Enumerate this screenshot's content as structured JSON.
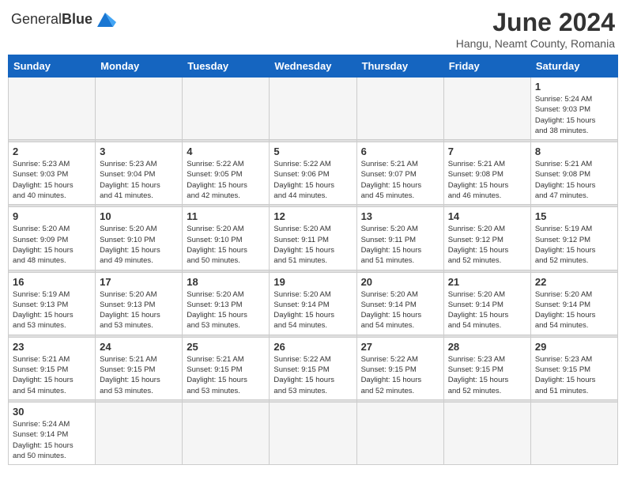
{
  "header": {
    "logo_text_normal": "General",
    "logo_text_bold": "Blue",
    "title": "June 2024",
    "subtitle": "Hangu, Neamt County, Romania"
  },
  "weekdays": [
    "Sunday",
    "Monday",
    "Tuesday",
    "Wednesday",
    "Thursday",
    "Friday",
    "Saturday"
  ],
  "weeks": [
    [
      {
        "day": "",
        "info": ""
      },
      {
        "day": "",
        "info": ""
      },
      {
        "day": "",
        "info": ""
      },
      {
        "day": "",
        "info": ""
      },
      {
        "day": "",
        "info": ""
      },
      {
        "day": "",
        "info": ""
      },
      {
        "day": "1",
        "info": "Sunrise: 5:24 AM\nSunset: 9:03 PM\nDaylight: 15 hours\nand 38 minutes."
      }
    ],
    [
      {
        "day": "2",
        "info": "Sunrise: 5:23 AM\nSunset: 9:03 PM\nDaylight: 15 hours\nand 40 minutes."
      },
      {
        "day": "3",
        "info": "Sunrise: 5:23 AM\nSunset: 9:04 PM\nDaylight: 15 hours\nand 41 minutes."
      },
      {
        "day": "4",
        "info": "Sunrise: 5:22 AM\nSunset: 9:05 PM\nDaylight: 15 hours\nand 42 minutes."
      },
      {
        "day": "5",
        "info": "Sunrise: 5:22 AM\nSunset: 9:06 PM\nDaylight: 15 hours\nand 44 minutes."
      },
      {
        "day": "6",
        "info": "Sunrise: 5:21 AM\nSunset: 9:07 PM\nDaylight: 15 hours\nand 45 minutes."
      },
      {
        "day": "7",
        "info": "Sunrise: 5:21 AM\nSunset: 9:08 PM\nDaylight: 15 hours\nand 46 minutes."
      },
      {
        "day": "8",
        "info": "Sunrise: 5:21 AM\nSunset: 9:08 PM\nDaylight: 15 hours\nand 47 minutes."
      }
    ],
    [
      {
        "day": "9",
        "info": "Sunrise: 5:20 AM\nSunset: 9:09 PM\nDaylight: 15 hours\nand 48 minutes."
      },
      {
        "day": "10",
        "info": "Sunrise: 5:20 AM\nSunset: 9:10 PM\nDaylight: 15 hours\nand 49 minutes."
      },
      {
        "day": "11",
        "info": "Sunrise: 5:20 AM\nSunset: 9:10 PM\nDaylight: 15 hours\nand 50 minutes."
      },
      {
        "day": "12",
        "info": "Sunrise: 5:20 AM\nSunset: 9:11 PM\nDaylight: 15 hours\nand 51 minutes."
      },
      {
        "day": "13",
        "info": "Sunrise: 5:20 AM\nSunset: 9:11 PM\nDaylight: 15 hours\nand 51 minutes."
      },
      {
        "day": "14",
        "info": "Sunrise: 5:20 AM\nSunset: 9:12 PM\nDaylight: 15 hours\nand 52 minutes."
      },
      {
        "day": "15",
        "info": "Sunrise: 5:19 AM\nSunset: 9:12 PM\nDaylight: 15 hours\nand 52 minutes."
      }
    ],
    [
      {
        "day": "16",
        "info": "Sunrise: 5:19 AM\nSunset: 9:13 PM\nDaylight: 15 hours\nand 53 minutes."
      },
      {
        "day": "17",
        "info": "Sunrise: 5:20 AM\nSunset: 9:13 PM\nDaylight: 15 hours\nand 53 minutes."
      },
      {
        "day": "18",
        "info": "Sunrise: 5:20 AM\nSunset: 9:13 PM\nDaylight: 15 hours\nand 53 minutes."
      },
      {
        "day": "19",
        "info": "Sunrise: 5:20 AM\nSunset: 9:14 PM\nDaylight: 15 hours\nand 54 minutes."
      },
      {
        "day": "20",
        "info": "Sunrise: 5:20 AM\nSunset: 9:14 PM\nDaylight: 15 hours\nand 54 minutes."
      },
      {
        "day": "21",
        "info": "Sunrise: 5:20 AM\nSunset: 9:14 PM\nDaylight: 15 hours\nand 54 minutes."
      },
      {
        "day": "22",
        "info": "Sunrise: 5:20 AM\nSunset: 9:14 PM\nDaylight: 15 hours\nand 54 minutes."
      }
    ],
    [
      {
        "day": "23",
        "info": "Sunrise: 5:21 AM\nSunset: 9:15 PM\nDaylight: 15 hours\nand 54 minutes."
      },
      {
        "day": "24",
        "info": "Sunrise: 5:21 AM\nSunset: 9:15 PM\nDaylight: 15 hours\nand 53 minutes."
      },
      {
        "day": "25",
        "info": "Sunrise: 5:21 AM\nSunset: 9:15 PM\nDaylight: 15 hours\nand 53 minutes."
      },
      {
        "day": "26",
        "info": "Sunrise: 5:22 AM\nSunset: 9:15 PM\nDaylight: 15 hours\nand 53 minutes."
      },
      {
        "day": "27",
        "info": "Sunrise: 5:22 AM\nSunset: 9:15 PM\nDaylight: 15 hours\nand 52 minutes."
      },
      {
        "day": "28",
        "info": "Sunrise: 5:23 AM\nSunset: 9:15 PM\nDaylight: 15 hours\nand 52 minutes."
      },
      {
        "day": "29",
        "info": "Sunrise: 5:23 AM\nSunset: 9:15 PM\nDaylight: 15 hours\nand 51 minutes."
      }
    ],
    [
      {
        "day": "30",
        "info": "Sunrise: 5:24 AM\nSunset: 9:14 PM\nDaylight: 15 hours\nand 50 minutes."
      },
      {
        "day": "",
        "info": ""
      },
      {
        "day": "",
        "info": ""
      },
      {
        "day": "",
        "info": ""
      },
      {
        "day": "",
        "info": ""
      },
      {
        "day": "",
        "info": ""
      },
      {
        "day": "",
        "info": ""
      }
    ]
  ]
}
